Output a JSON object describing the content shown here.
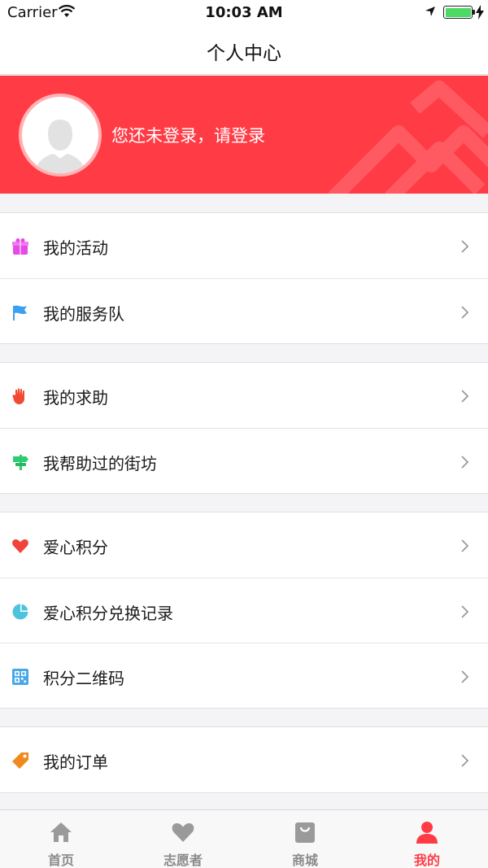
{
  "status_bar": {
    "carrier": "Carrier",
    "time": "10:03 AM"
  },
  "nav": {
    "title": "个人中心"
  },
  "profile": {
    "login_prompt": "您还未登录，请登录"
  },
  "menu": {
    "group1": [
      {
        "label": "我的活动",
        "icon": "gift-icon",
        "color": "#e64be6"
      },
      {
        "label": "我的服务队",
        "icon": "flag-icon",
        "color": "#3aa0f0"
      }
    ],
    "group2": [
      {
        "label": "我的求助",
        "icon": "hand-icon",
        "color": "#f04a32"
      },
      {
        "label": "我帮助过的街坊",
        "icon": "signpost-icon",
        "color": "#2ecc71"
      }
    ],
    "group3": [
      {
        "label": "爱心积分",
        "icon": "heart-icon",
        "color": "#f0443a"
      },
      {
        "label": "爱心积分兑换记录",
        "icon": "pie-chart-icon",
        "color": "#4ec3dc"
      },
      {
        "label": "积分二维码",
        "icon": "qr-code-icon",
        "color": "#4aa8e8"
      }
    ],
    "group4": [
      {
        "label": "我的订单",
        "icon": "tag-icon",
        "color": "#f08a1e"
      }
    ]
  },
  "tabs": [
    {
      "label": "首页",
      "icon": "home-icon"
    },
    {
      "label": "志愿者",
      "icon": "heart-icon"
    },
    {
      "label": "商城",
      "icon": "shopping-bag-icon"
    },
    {
      "label": "我的",
      "icon": "person-icon",
      "active": true
    }
  ],
  "colors": {
    "accent": "#ff3c46",
    "tab_inactive": "#8a8a8a"
  }
}
